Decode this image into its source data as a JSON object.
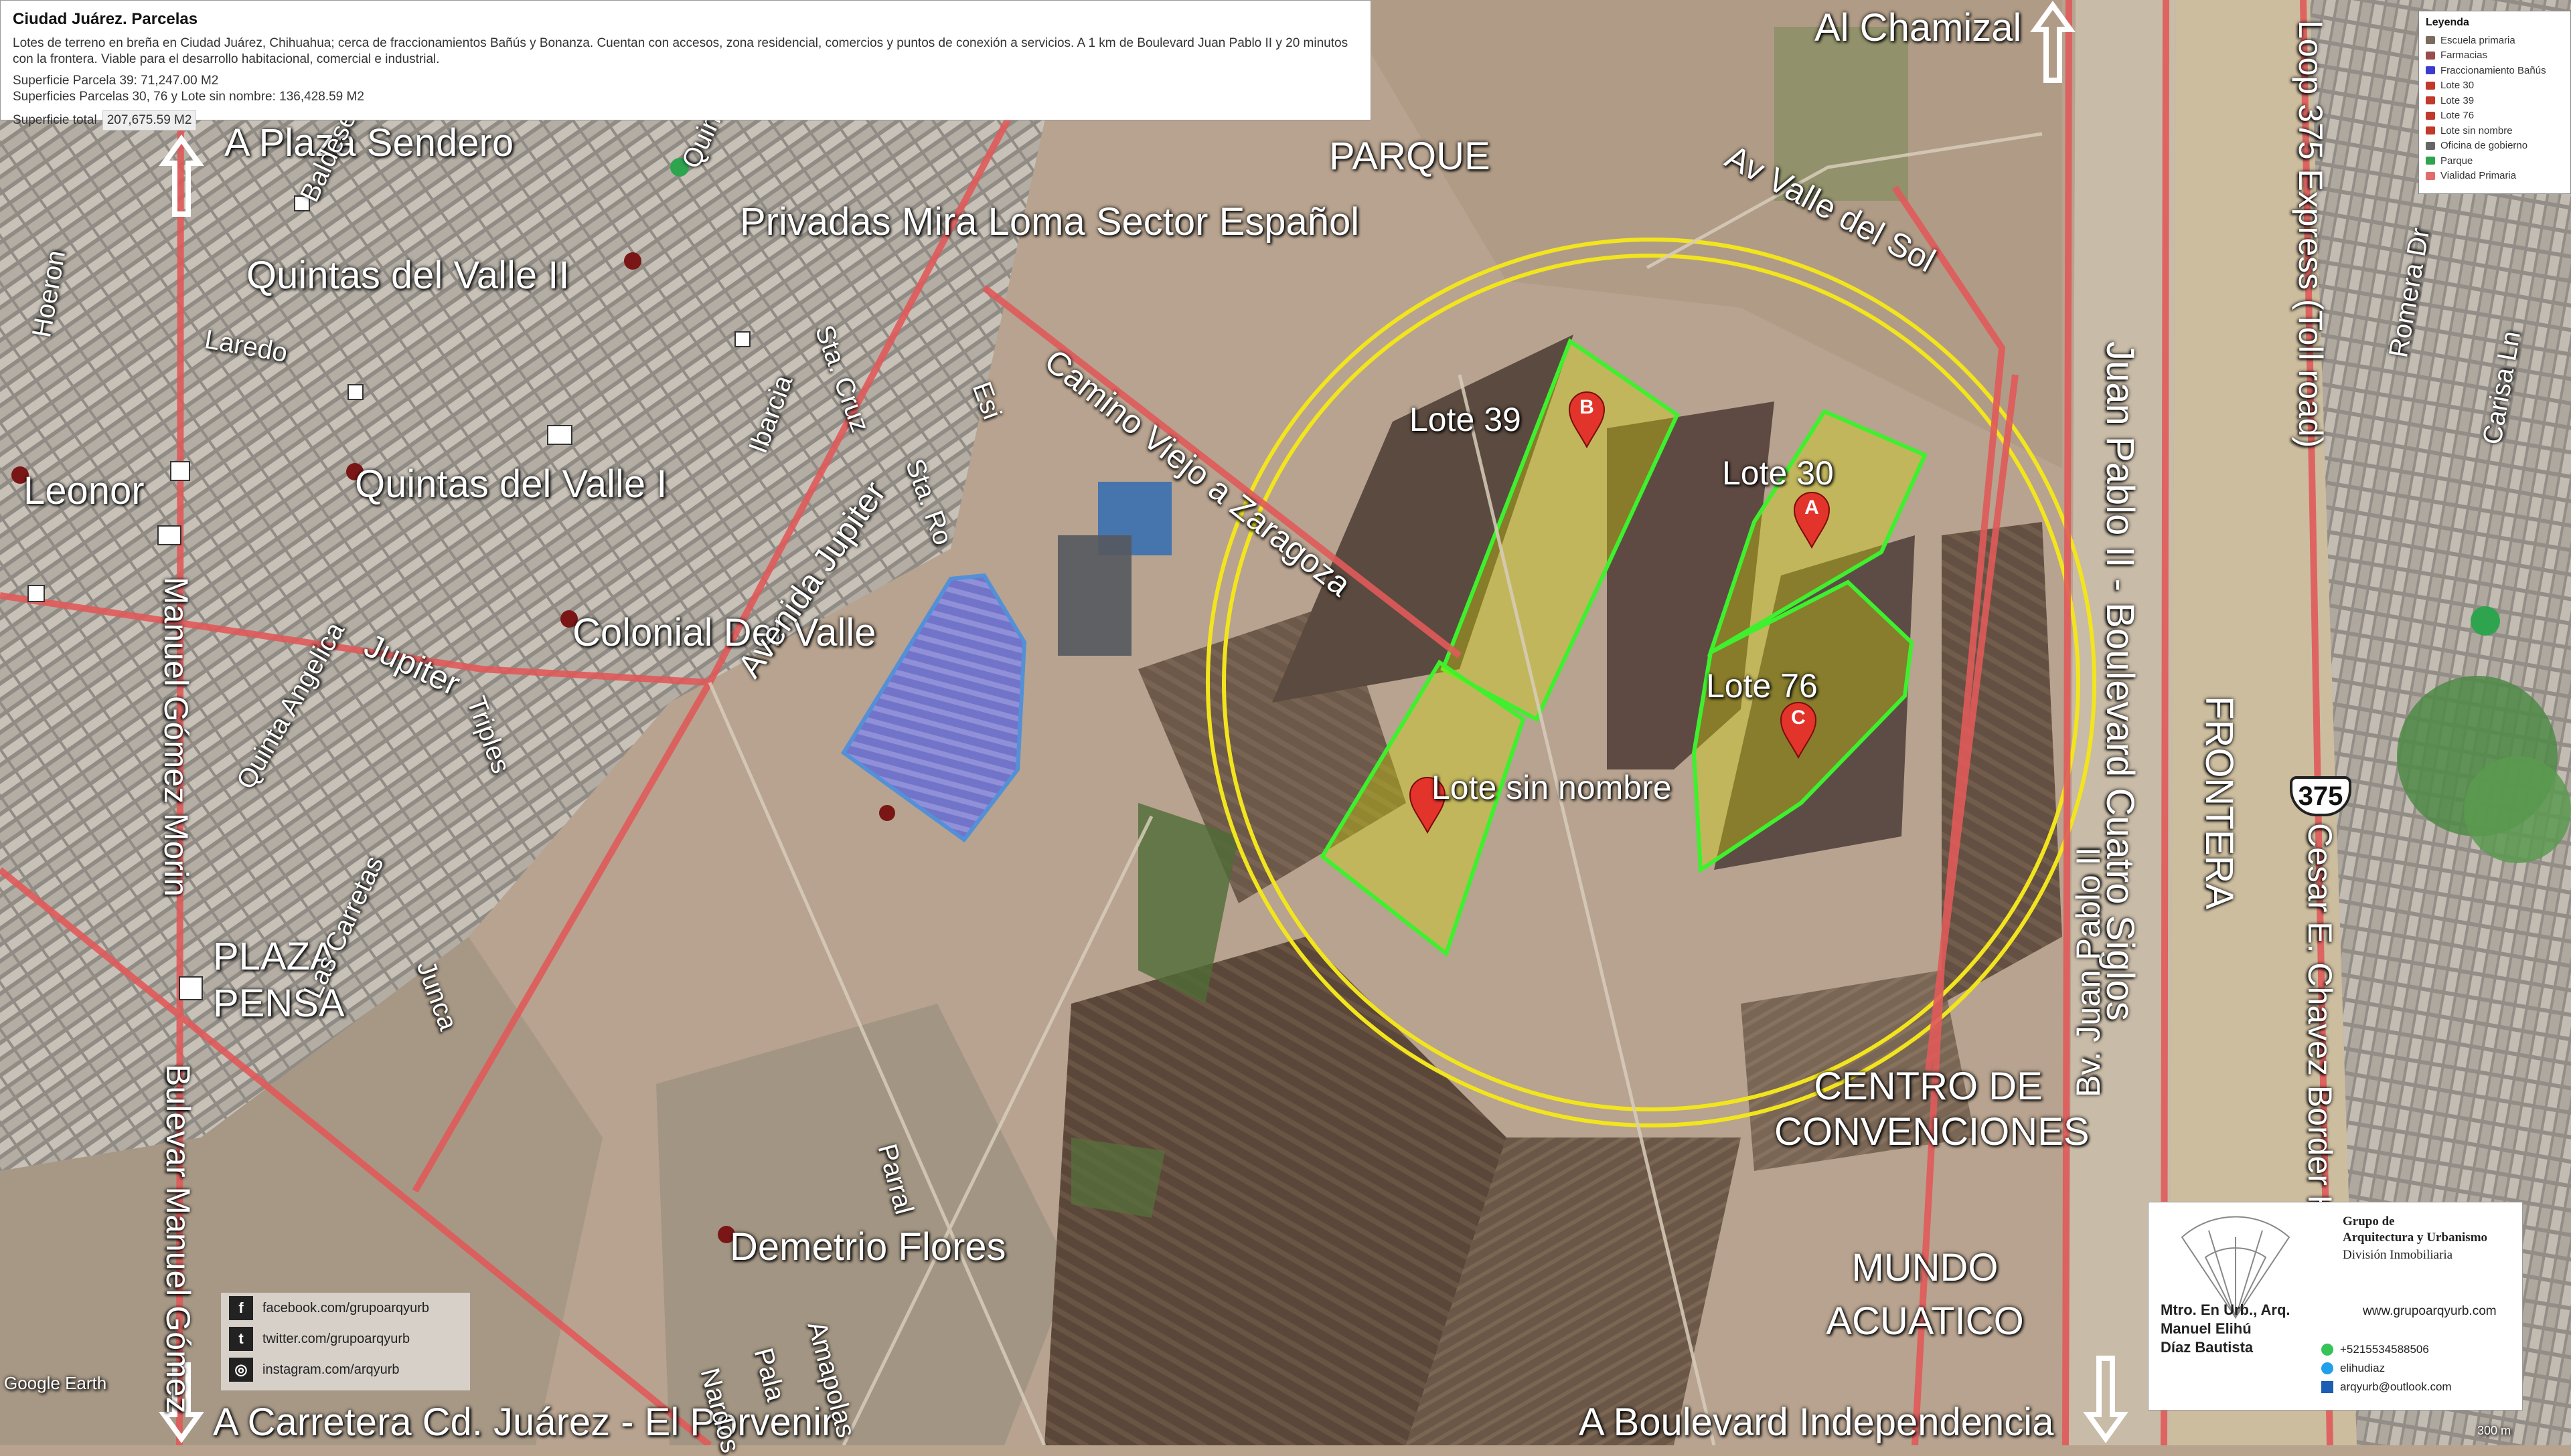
{
  "info": {
    "title": "Ciudad Juárez. Parcelas",
    "description": "Lotes de terreno en breña en Ciudad Juárez, Chihuahua; cerca de fraccionamientos Bañús y Bonanza. Cuentan con accesos, zona residencial, comercios y puntos de conexión a servicios. A 1 km de Boulevard Juan Pablo II y 20 minutos con la frontera. Viable para el desarrollo habitacional, comercial e industrial.",
    "line1": "Superficie Parcela 39: 71,247.00 M2",
    "line2": "Superficies Parcelas 30, 76 y Lote sin nombre: 136,428.59 M2",
    "total_label": "Superficie total",
    "total_value": "207,675.59 M2"
  },
  "legend": {
    "title": "Leyenda",
    "items": [
      {
        "label": "Escuela primaria",
        "color": "#7a6b5a"
      },
      {
        "label": "Farmacias",
        "color": "#9a4b4b"
      },
      {
        "label": "Fraccionamiento Bañús",
        "color": "#3b3bd0"
      },
      {
        "label": "Lote 30",
        "color": "#c0392b"
      },
      {
        "label": "Lote 39",
        "color": "#c0392b"
      },
      {
        "label": "Lote 76",
        "color": "#c0392b"
      },
      {
        "label": "Lote sin nombre",
        "color": "#c0392b"
      },
      {
        "label": "Oficina de gobierno",
        "color": "#666666"
      },
      {
        "label": "Parque",
        "color": "#2ea44f"
      },
      {
        "label": "Vialidad Primaria",
        "color": "#e26b6b"
      }
    ]
  },
  "map": {
    "places": {
      "al_chamizal": "Al Chamizal",
      "a_plaza_sendero": "A Plaza Sendero",
      "parque": "PARQUE",
      "privadas": "Privadas Mira Loma Sector Español",
      "quintas_valle_ii": "Quintas del Valle II",
      "quintas_valle_i": "Quintas del Valle I",
      "leonor": "Leonor",
      "colonial_valle": "Colonial Del Valle",
      "plaza_pensa": "PLAZA PENSA",
      "demetrio": "Demetrio Flores",
      "centro": "CENTRO DE CONVENCIONES",
      "mundo": "MUNDO ACUATICO",
      "frontera": "FRONTERA",
      "a_carretera": "A Carretera Cd. Juárez - El Porvenir",
      "a_boulevard": "A Boulevard Independencia",
      "google_earth": "Google Earth",
      "scale": "300 m"
    },
    "streets": {
      "av_valle_sol": "Av Valle del Sol",
      "camino_viejo": "Camino Viejo a Zaragoza",
      "juan_pablo": "Juan Pablo II - Boulevard Cuatro Siglos",
      "bv_juan_pablo": "Bv. Juan Pablo II",
      "loop": "Loop 375 Express (Toll road)",
      "cesar": "Cesar E. Chavez Border Hwy",
      "romera": "Romera Dr",
      "carisa": "Carisa Ln",
      "manuel_gomez": "Manuel Gómez Morin",
      "bulevar_manuel": "Bulevar Manuel Gómez",
      "avenida_jupiter": "Avenida Jupiter",
      "jupiter": "Jupiter",
      "quinta_angelica": "Quinta Angelica",
      "laredo": "Laredo",
      "hoeron": "Hoeron",
      "ibarcia": "Ibarcia",
      "sta_cruz": "Sta. Cruz",
      "esi": "Esi",
      "sta_ro": "Sta. Ro",
      "quinta_blanca": "Quinta Blanca",
      "baldeses": "Baldeses",
      "triples": "Triples",
      "las_carretas": "Las Carretas",
      "junca": "Junca",
      "parral": "Parral",
      "nardos": "Nardos",
      "amapolas": "Amapolas",
      "pala": "Pala"
    },
    "lots": {
      "lote39": "Lote 39",
      "lote30": "Lote 30",
      "lote76": "Lote 76",
      "sin_nombre": "Lote sin nombre"
    },
    "markers": {
      "a": "A",
      "b": "B",
      "c": "C"
    },
    "route_shield": "375"
  },
  "social": {
    "facebook": "facebook.com/grupoarqyurb",
    "twitter": "twitter.com/grupoarqyurb",
    "instagram": "instagram.com/arqyurb",
    "fb_icon": "f",
    "tw_icon": "t",
    "ig_icon": "◎"
  },
  "card": {
    "company1": "Grupo de",
    "company2": "Arquitectura y Urbanismo",
    "division": "División Inmobiliaria",
    "web": "www.grupoarqyurb.com",
    "title1": "Mtro. En Urb., Arq.",
    "title2": "Manuel Elihú",
    "title3": "Díaz Bautista",
    "phone": "+5215534588506",
    "skype": "elihudiaz",
    "email": "arqyurb@outlook.com"
  }
}
